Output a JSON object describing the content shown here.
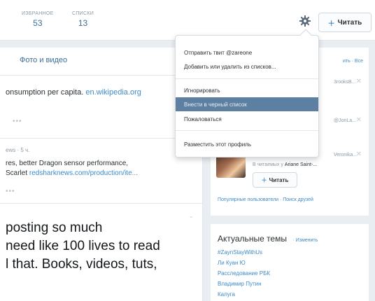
{
  "profile": {
    "stats": [
      {
        "label": "ИЗБРАННОЕ",
        "value": "53"
      },
      {
        "label": "СПИСКИ",
        "value": "13"
      }
    ],
    "gear_icon": "gear-icon",
    "follow_label": "Читать"
  },
  "main": {
    "media_header": "Фото и видео",
    "tweet1": {
      "text": "onsumption per capita.",
      "link": "en.wikipedia.org",
      "more": "•••"
    },
    "tweet2": {
      "meta": "ews · 5 ч.",
      "line1": "res, better Dragon sensor performance,",
      "line2_text": "Scarlet",
      "line2_link": "redsharknews.com/production/ite...",
      "more": "•••"
    },
    "tweet3": {
      "lines": [
        "posting so much",
        "need like 100 lives to read",
        "l that. Books, videos, tuts,"
      ]
    }
  },
  "menu": {
    "items": [
      {
        "label": "Отправить твит @zareone"
      },
      {
        "label": "Добавить или удалить из списков..."
      },
      {
        "label": "Игнорировать"
      },
      {
        "label": "Внести в черный список"
      },
      {
        "label": "Пожаловаться"
      },
      {
        "label": "Разместить этот профиль"
      }
    ],
    "active_index": 3
  },
  "sidebar": {
    "suggest_links": "ить · Все",
    "suggestions": [
      {
        "name": "3rooksB..."
      },
      {
        "name": "@JonLa..."
      },
      {
        "name": "Veronika..."
      }
    ],
    "reads_text": "В читаемых у",
    "reads_name": "Ariane Saint-...",
    "follow_label": "Читать",
    "links": "Популярные пользователи · Поиск друзей",
    "trends_title": "Актуальные темы",
    "trends_change": "· Изменить",
    "trends": [
      "#ZaynStayWithUs",
      "Ли Куан Ю",
      "Расследование РБК",
      "Владимир Путин",
      "Калуга"
    ]
  },
  "colors": {
    "accent": "#3b8ac9",
    "menu_highlight": "#5d7fa1"
  }
}
